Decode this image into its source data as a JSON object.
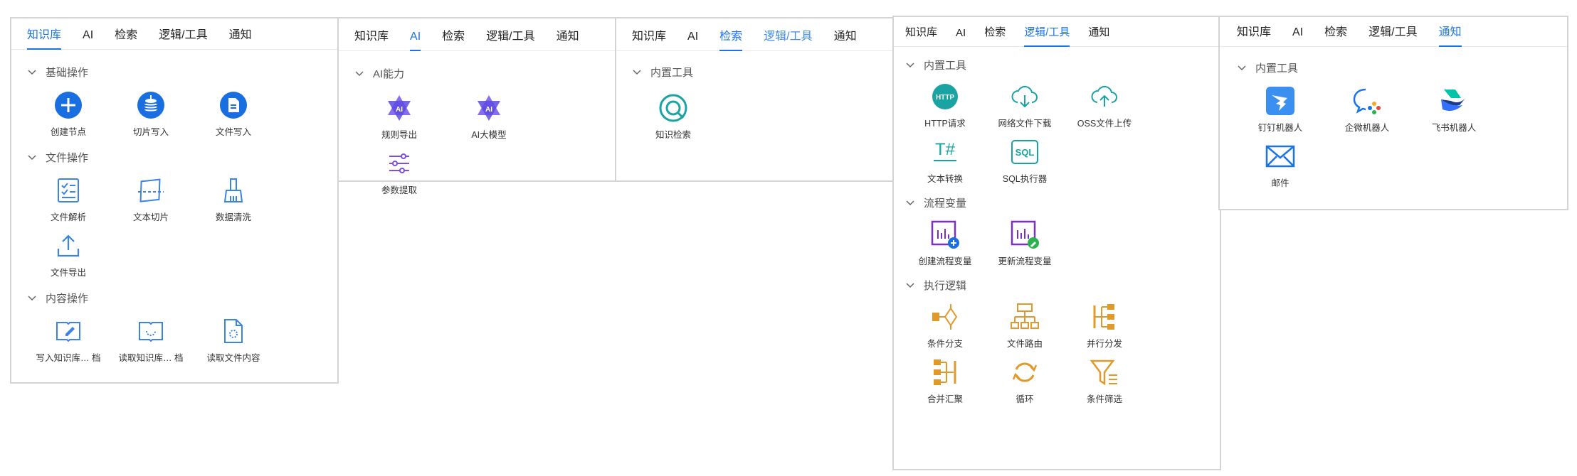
{
  "tabs": [
    "知识库",
    "AI",
    "检索",
    "逻辑/工具",
    "通知"
  ],
  "colors": {
    "accent": "#1a73e8",
    "blue_icon": "#3b83e6",
    "purple_icon": "#7b4ee6",
    "orange_icon": "#e09a2c",
    "teal_icon": "#1aa3a3",
    "green_badge": "#2bb24c"
  },
  "panel1": {
    "sections": [
      {
        "title": "基础操作",
        "items": [
          {
            "label": "创建节点",
            "icon": "plus-circle-icon"
          },
          {
            "label": "切片写入",
            "icon": "db-down-icon"
          },
          {
            "label": "文件写入",
            "icon": "file-doc-icon"
          }
        ]
      },
      {
        "title": "文件操作",
        "items": [
          {
            "label": "文件解析",
            "icon": "checklist-icon"
          },
          {
            "label": "文本切片",
            "icon": "slice-icon"
          },
          {
            "label": "数据清洗",
            "icon": "broom-icon"
          },
          {
            "label": "文件导出",
            "icon": "upload-icon"
          }
        ]
      },
      {
        "title": "内容操作",
        "items": [
          {
            "label": "写入知识库… 档",
            "icon": "book-edit-icon"
          },
          {
            "label": "读取知识库… 档",
            "icon": "book-read-icon"
          },
          {
            "label": "读取文件内容",
            "icon": "file-read-icon"
          }
        ]
      }
    ]
  },
  "panel2": {
    "sections": [
      {
        "title": "AI能力",
        "items": [
          {
            "label": "规则导出",
            "icon": "ai-star-icon"
          },
          {
            "label": "AI大模型",
            "icon": "ai-star-icon"
          },
          {
            "label": "参数提取",
            "icon": "sliders-icon"
          }
        ]
      }
    ]
  },
  "panel3": {
    "sections": [
      {
        "title": "内置工具",
        "items": [
          {
            "label": "知识检索",
            "icon": "target-search-icon"
          }
        ]
      }
    ]
  },
  "panel4": {
    "sections": [
      {
        "title": "内置工具",
        "items": [
          {
            "label": "HTTP请求",
            "icon": "http-globe-icon"
          },
          {
            "label": "网络文件下载",
            "icon": "cloud-download-icon"
          },
          {
            "label": "OSS文件上传",
            "icon": "cloud-upload-icon"
          },
          {
            "label": "文本转换",
            "icon": "text-convert-icon"
          },
          {
            "label": "SQL执行器",
            "icon": "sql-icon"
          }
        ]
      },
      {
        "title": "流程变量",
        "items": [
          {
            "label": "创建流程变量",
            "icon": "var-create-icon"
          },
          {
            "label": "更新流程变量",
            "icon": "var-update-icon"
          }
        ]
      },
      {
        "title": "执行逻辑",
        "items": [
          {
            "label": "条件分支",
            "icon": "branch-icon"
          },
          {
            "label": "文件路由",
            "icon": "route-icon"
          },
          {
            "label": "并行分发",
            "icon": "parallel-icon"
          },
          {
            "label": "合并汇聚",
            "icon": "merge-icon"
          },
          {
            "label": "循环",
            "icon": "loop-icon"
          },
          {
            "label": "条件筛选",
            "icon": "filter-icon"
          }
        ]
      }
    ]
  },
  "panel5": {
    "sections": [
      {
        "title": "内置工具",
        "items": [
          {
            "label": "钉钉机器人",
            "icon": "dingtalk-icon"
          },
          {
            "label": "企微机器人",
            "icon": "wecom-icon"
          },
          {
            "label": "飞书机器人",
            "icon": "feishu-icon"
          },
          {
            "label": "邮件",
            "icon": "mail-icon"
          }
        ]
      }
    ]
  }
}
